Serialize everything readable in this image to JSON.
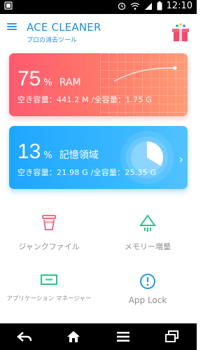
{
  "status_bar": {
    "time": "12:10"
  },
  "app_bar": {
    "title": "ACE CLEANER",
    "subtitle": "プロの消去ツール"
  },
  "ram_card": {
    "percent": "75",
    "percent_unit": "%",
    "label": "RAM",
    "capacity_text": "空き容量：441.2 M /全容量：1.75 G",
    "color": "#ff5a70"
  },
  "storage_card": {
    "percent": "13",
    "percent_unit": "%",
    "label": "記憶領域",
    "capacity_text": "空き容量：21.98 G /全容量：25.35 G",
    "usage_fraction": 0.13,
    "color": "#1ea6ff"
  },
  "tools": [
    {
      "label": "ジャンクファイル",
      "icon": "trash-icon",
      "color": "#f26d7d"
    },
    {
      "label": "メモリー増量",
      "icon": "boost-arrow-icon",
      "color": "#2ec486"
    },
    {
      "label": "アプリケーション マネージャー",
      "icon": "app-manager-icon",
      "color": "#2ec486"
    },
    {
      "label": "App Lock",
      "icon": "info-circle-icon",
      "color": "#1e9be5"
    }
  ],
  "nav": [
    "back-icon",
    "home-icon",
    "menu-icon",
    "recents-icon"
  ]
}
